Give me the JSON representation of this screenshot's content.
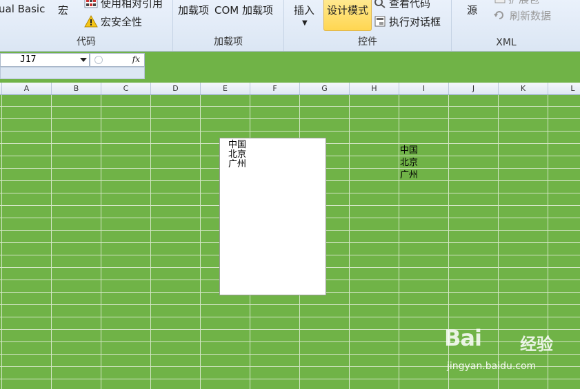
{
  "ribbon": {
    "code_group": {
      "label": "代码",
      "visual_basic": "ual Basic",
      "macros": "宏",
      "relative_refs": "使用相对引用",
      "macro_security": "宏安全性"
    },
    "addins_group": {
      "label": "加载项",
      "addins": "加载项",
      "com_addins": "COM 加载项"
    },
    "controls_group": {
      "label": "控件",
      "insert": "插入",
      "design_mode": "设计模式",
      "view_code": "查看代码",
      "run_dialog": "执行对话框"
    },
    "xml_group": {
      "label": "XML",
      "source": "源",
      "expansion_packs": "扩展包",
      "refresh_data": "刷新数据"
    }
  },
  "formula_bar": {
    "name_box": "J17",
    "fx_label": "fx"
  },
  "columns": [
    "A",
    "B",
    "C",
    "D",
    "E",
    "F",
    "G",
    "H",
    "I",
    "J",
    "K",
    "L"
  ],
  "listbox_items": [
    "中国",
    "北京",
    "广州"
  ],
  "cell_values": [
    "中国",
    "北京",
    "广州"
  ],
  "watermark": {
    "brand": "Bai",
    "suffix": "经验",
    "url": "jingyan.baidu.com"
  },
  "colors": {
    "sheet_background": "#70b347",
    "ribbon": "#dbe6f4",
    "design_mode_active": "#ffd651"
  }
}
